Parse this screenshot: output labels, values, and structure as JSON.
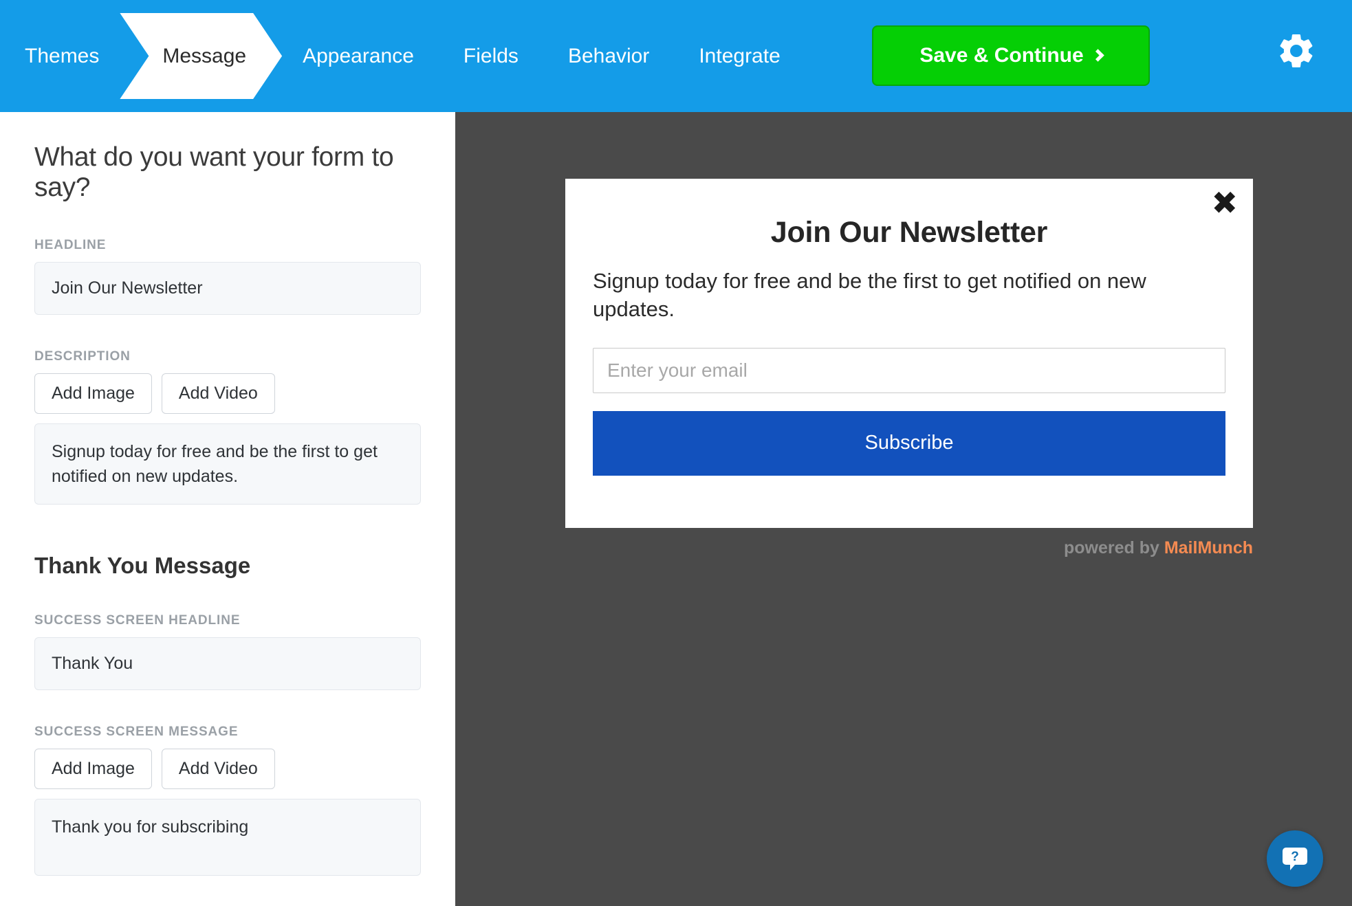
{
  "header": {
    "nav_items": [
      {
        "label": "Themes",
        "active": false
      },
      {
        "label": "Message",
        "active": true
      },
      {
        "label": "Appearance",
        "active": false
      },
      {
        "label": "Fields",
        "active": false
      },
      {
        "label": "Behavior",
        "active": false
      },
      {
        "label": "Integrate",
        "active": false
      }
    ],
    "save_label": "Save & Continue",
    "settings_icon": "gear-icon",
    "bg_color": "#149ce8",
    "save_color": "#05cf05"
  },
  "editor": {
    "title": "What do you want your form to say?",
    "headline_label": "HEADLINE",
    "headline_value": "Join Our Newsletter",
    "description_label": "DESCRIPTION",
    "description_value": "Signup today for free and be the first to get notified on new updates.",
    "add_image_label": "Add Image",
    "add_video_label": "Add Video",
    "thank_you_section": "Thank You Message",
    "success_headline_label": "SUCCESS SCREEN HEADLINE",
    "success_headline_value": "Thank You",
    "success_message_label": "SUCCESS SCREEN MESSAGE",
    "success_message_value": "Thank you for subscribing"
  },
  "preview": {
    "bg_color": "#4a4a4a",
    "close_icon": "close-icon",
    "headline": "Join Our Newsletter",
    "description": "Signup today for free and be the first to get notified on new updates.",
    "email_placeholder": "Enter your email",
    "email_value": "",
    "submit_label": "Subscribe",
    "submit_color": "#1251bd",
    "powered_prefix": "powered by ",
    "powered_brand": "MailMunch",
    "brand_color": "#f58b52"
  },
  "help": {
    "icon": "question-chat-icon",
    "color": "#1271b4"
  }
}
